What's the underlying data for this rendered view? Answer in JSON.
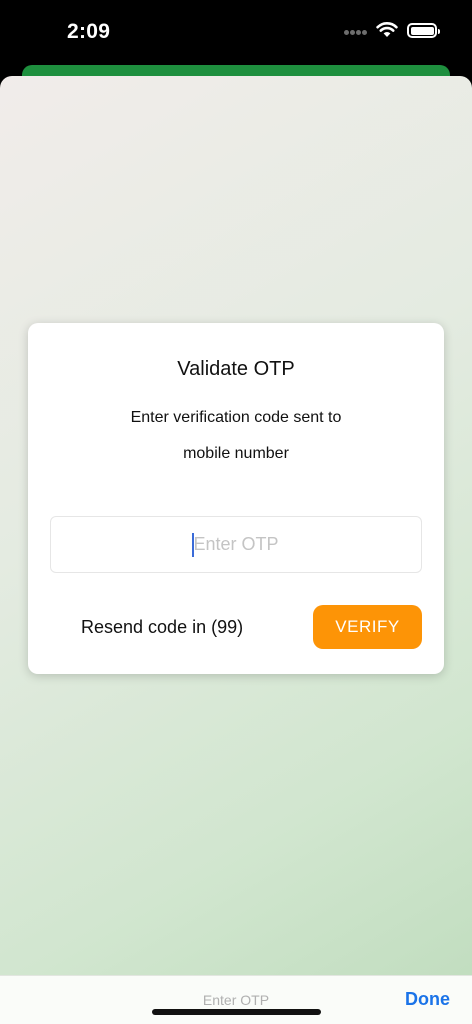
{
  "status_bar": {
    "time": "2:09",
    "icons": [
      "signal-dots-icon",
      "wifi-icon",
      "battery-icon"
    ]
  },
  "dialog": {
    "title": "Validate OTP",
    "line_1": "Enter verification code sent to",
    "line_2": "mobile number",
    "otp_input": {
      "value": "",
      "placeholder": "Enter OTP"
    },
    "resend_label": "Resend code in (99)",
    "verify_label": "VERIFY"
  },
  "keyboard_toolbar": {
    "placeholder": "Enter OTP",
    "done_label": "Done"
  },
  "colors": {
    "accent_orange": "#fd9406",
    "header_green": "#1e8f3e",
    "done_blue": "#1a73e8",
    "caret_blue": "#3a6bd8"
  }
}
